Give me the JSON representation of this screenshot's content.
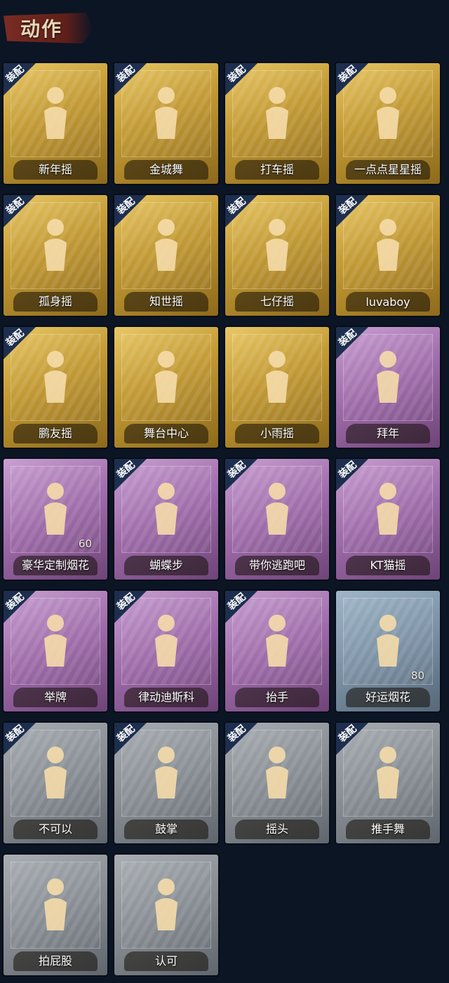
{
  "header": {
    "title": "动作"
  },
  "equip_tag": "装配",
  "cards": [
    {
      "name": "新年摇",
      "style": "gold",
      "equipped": true
    },
    {
      "name": "金城舞",
      "style": "gold",
      "equipped": true
    },
    {
      "name": "打车摇",
      "style": "gold",
      "equipped": true
    },
    {
      "name": "一点点星星摇",
      "style": "gold",
      "equipped": true
    },
    {
      "name": "孤身摇",
      "style": "gold",
      "equipped": true
    },
    {
      "name": "知世摇",
      "style": "gold",
      "equipped": true
    },
    {
      "name": "七仔摇",
      "style": "gold",
      "equipped": true
    },
    {
      "name": "luvaboy",
      "style": "gold",
      "equipped": true
    },
    {
      "name": "鹏友摇",
      "style": "gold",
      "equipped": true
    },
    {
      "name": "舞台中心",
      "style": "gold",
      "equipped": false
    },
    {
      "name": "小雨摇",
      "style": "gold",
      "equipped": false
    },
    {
      "name": "拜年",
      "style": "purple",
      "equipped": true
    },
    {
      "name": "豪华定制烟花",
      "style": "purple",
      "equipped": false,
      "count": "60"
    },
    {
      "name": "蝴蝶步",
      "style": "purple",
      "equipped": true
    },
    {
      "name": "带你逃跑吧",
      "style": "purple",
      "equipped": true
    },
    {
      "name": "KT猫摇",
      "style": "purple",
      "equipped": true
    },
    {
      "name": "举牌",
      "style": "purple",
      "equipped": true
    },
    {
      "name": "律动迪斯科",
      "style": "purple",
      "equipped": true
    },
    {
      "name": "抬手",
      "style": "purple",
      "equipped": true
    },
    {
      "name": "好运烟花",
      "style": "blue",
      "equipped": false,
      "count": "80"
    },
    {
      "name": "不可以",
      "style": "gray",
      "equipped": true
    },
    {
      "name": "鼓掌",
      "style": "gray",
      "equipped": true
    },
    {
      "name": "摇头",
      "style": "gray",
      "equipped": true
    },
    {
      "name": "推手舞",
      "style": "gray",
      "equipped": true
    },
    {
      "name": "拍屁股",
      "style": "gray",
      "equipped": false
    },
    {
      "name": "认可",
      "style": "gray",
      "equipped": false
    }
  ]
}
